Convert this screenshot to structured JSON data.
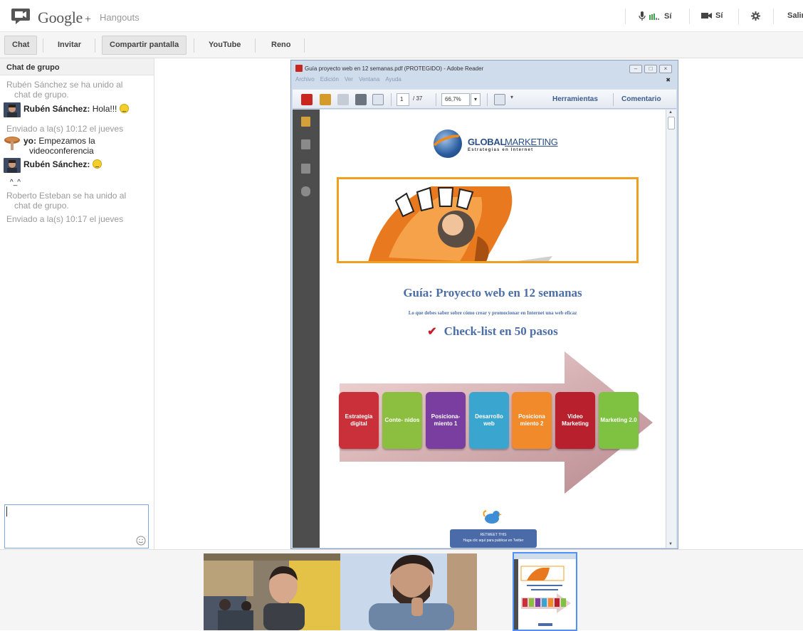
{
  "header": {
    "brand": "Google",
    "brand_plus": "+",
    "product": "Hangouts",
    "mic_label": "Sí",
    "cam_label": "Sí",
    "exit_label": "Salir"
  },
  "toolbar": {
    "tabs": [
      {
        "label": "Chat",
        "selected": true
      },
      {
        "label": "Invitar",
        "selected": false
      },
      {
        "label": "Compartir pantalla",
        "selected": true
      },
      {
        "label": "YouTube",
        "selected": false
      },
      {
        "label": "Reno",
        "selected": false
      }
    ]
  },
  "chat": {
    "header": "Chat de grupo",
    "joined_1_a": "Rubén Sánchez se ha unido al",
    "joined_1_b": "chat de grupo.",
    "msg_1_author": "Rubén Sánchez:",
    "msg_1_text": "Hola!!!",
    "sent_1": "Enviado a la(s) 10:12 el jueves",
    "msg_2_author": "yo:",
    "msg_2_text_a": "Empezamos la",
    "msg_2_text_b": "videoconferencia",
    "msg_3_author": "Rubén Sánchez:",
    "msg_4_text": "^_^",
    "joined_2_a": "Roberto Esteban se ha unido al",
    "joined_2_b": "chat de grupo.",
    "sent_2": "Enviado a la(s) 10:17 el jueves",
    "input_value": ""
  },
  "reader": {
    "title": "Guía proyecto web en 12 semanas.pdf (PROTEGIDO) - Adobe Reader",
    "menu": [
      "Archivo",
      "Edición",
      "Ver",
      "Ventana",
      "Ayuda"
    ],
    "page_current": "1",
    "page_total": "/ 37",
    "zoom": "66,7%",
    "tools_label": "Herramientas",
    "comment_label": "Comentario"
  },
  "pdf": {
    "brand_a": "GLOBAL",
    "brand_b": "MARKETING",
    "tagline": "Estrategias en Internet",
    "title": "Guía: Proyecto web en 12 semanas",
    "subtitle": "Lo que debes saber sobre cómo crear y promocionar en Internet una web eficaz",
    "checklist": "Check-list en 50 pasos",
    "steps": [
      {
        "label": "Estrategia digital",
        "color": "#c9303a"
      },
      {
        "label": "Conte- nidos",
        "color": "#8cbf3f"
      },
      {
        "label": "Posiciona- miento 1",
        "color": "#7a3ea0"
      },
      {
        "label": "Desarrollo web",
        "color": "#3aa6cf"
      },
      {
        "label": "Posiciona miento 2",
        "color": "#f08a2a"
      },
      {
        "label": "Video Marketing",
        "color": "#b8202e"
      },
      {
        "label": "Marketing 2.0",
        "color": "#7fc241"
      }
    ],
    "retweet_a": "RETWEET THIS",
    "retweet_b": "Haga clic aquí para publicar en Twitter"
  },
  "colors": {
    "accent": "#4d90fe",
    "toolbar_bg": "#f5f5f5",
    "reader_frame": "#cfdcec"
  }
}
